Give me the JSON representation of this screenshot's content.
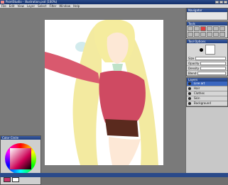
{
  "window": {
    "title": "PaintStudio  -  illustration.psd  (100%)"
  },
  "menu": [
    "File",
    "Edit",
    "View",
    "Layer",
    "Select",
    "Filter",
    "Window",
    "Help"
  ],
  "colors": {
    "accent": "#14306a",
    "selected_layer": "#3a66c0",
    "primary": "#c8336a",
    "secondary": "#ffffff"
  },
  "color_panel": {
    "title": "Color Circle"
  },
  "navigator": {
    "title": "Navigator"
  },
  "tools_panel": {
    "title": "Tools"
  },
  "tool_options": {
    "title": "Tool Options",
    "rows": [
      {
        "label": "Size"
      },
      {
        "label": "Opacity"
      },
      {
        "label": "Density"
      },
      {
        "label": "Blend"
      }
    ]
  },
  "layers_panel": {
    "title": "Layers",
    "items": [
      {
        "name": "Line art"
      },
      {
        "name": "Hair"
      },
      {
        "name": "Clothes"
      },
      {
        "name": "Skin"
      },
      {
        "name": "Background"
      }
    ]
  }
}
